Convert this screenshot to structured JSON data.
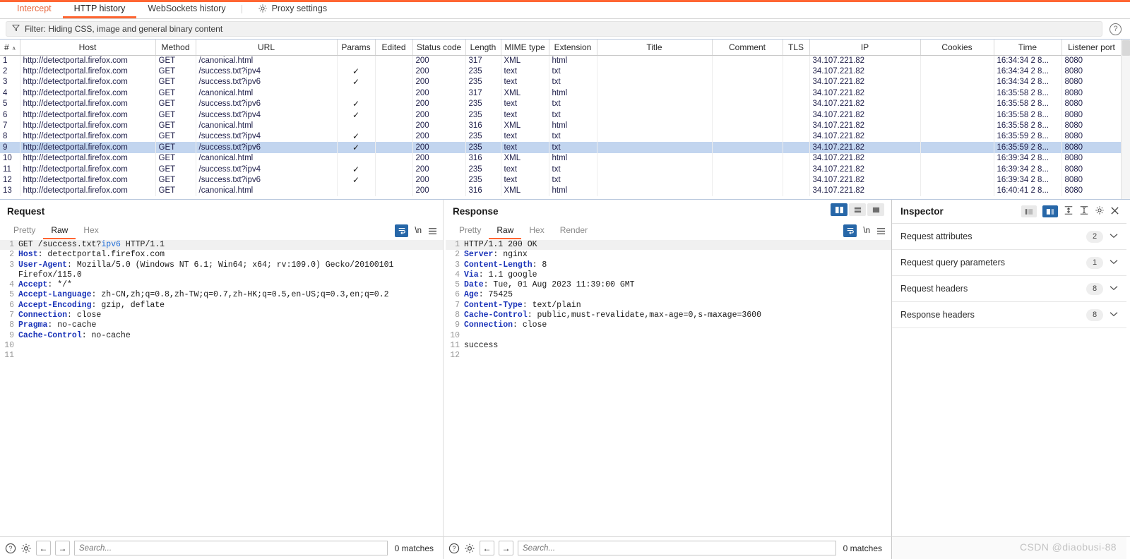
{
  "tabs": [
    {
      "label": "Intercept",
      "state": "intercept"
    },
    {
      "label": "HTTP history",
      "state": "active"
    },
    {
      "label": "WebSockets history",
      "state": "normal"
    },
    {
      "label": "Proxy settings",
      "state": "normal",
      "icon": "gear-icon"
    }
  ],
  "filter": {
    "icon": "funnel-icon",
    "text": "Filter: Hiding CSS, image and general binary content",
    "help_icon": "help-circle-icon"
  },
  "table": {
    "columns": [
      "#",
      "Host",
      "Method",
      "URL",
      "Params",
      "Edited",
      "Status code",
      "Length",
      "MIME type",
      "Extension",
      "Title",
      "Comment",
      "TLS",
      "IP",
      "Cookies",
      "Time",
      "Listener port"
    ],
    "sort_indicator": "∧",
    "check_glyph": "✓",
    "rows": [
      {
        "num": "1",
        "host": "http://detectportal.firefox.com",
        "method": "GET",
        "url": "/canonical.html",
        "params": "",
        "edited": "",
        "status": "200",
        "length": "317",
        "mime": "XML",
        "ext": "html",
        "title": "",
        "comment": "",
        "tls": "",
        "ip": "34.107.221.82",
        "cookies": "",
        "time": "16:34:34 2 8...",
        "port": "8080",
        "selected": false
      },
      {
        "num": "2",
        "host": "http://detectportal.firefox.com",
        "method": "GET",
        "url": "/success.txt?ipv4",
        "params": "✓",
        "edited": "",
        "status": "200",
        "length": "235",
        "mime": "text",
        "ext": "txt",
        "title": "",
        "comment": "",
        "tls": "",
        "ip": "34.107.221.82",
        "cookies": "",
        "time": "16:34:34 2 8...",
        "port": "8080",
        "selected": false
      },
      {
        "num": "3",
        "host": "http://detectportal.firefox.com",
        "method": "GET",
        "url": "/success.txt?ipv6",
        "params": "✓",
        "edited": "",
        "status": "200",
        "length": "235",
        "mime": "text",
        "ext": "txt",
        "title": "",
        "comment": "",
        "tls": "",
        "ip": "34.107.221.82",
        "cookies": "",
        "time": "16:34:34 2 8...",
        "port": "8080",
        "selected": false
      },
      {
        "num": "4",
        "host": "http://detectportal.firefox.com",
        "method": "GET",
        "url": "/canonical.html",
        "params": "",
        "edited": "",
        "status": "200",
        "length": "317",
        "mime": "XML",
        "ext": "html",
        "title": "",
        "comment": "",
        "tls": "",
        "ip": "34.107.221.82",
        "cookies": "",
        "time": "16:35:58 2 8...",
        "port": "8080",
        "selected": false
      },
      {
        "num": "5",
        "host": "http://detectportal.firefox.com",
        "method": "GET",
        "url": "/success.txt?ipv6",
        "params": "✓",
        "edited": "",
        "status": "200",
        "length": "235",
        "mime": "text",
        "ext": "txt",
        "title": "",
        "comment": "",
        "tls": "",
        "ip": "34.107.221.82",
        "cookies": "",
        "time": "16:35:58 2 8...",
        "port": "8080",
        "selected": false
      },
      {
        "num": "6",
        "host": "http://detectportal.firefox.com",
        "method": "GET",
        "url": "/success.txt?ipv4",
        "params": "✓",
        "edited": "",
        "status": "200",
        "length": "235",
        "mime": "text",
        "ext": "txt",
        "title": "",
        "comment": "",
        "tls": "",
        "ip": "34.107.221.82",
        "cookies": "",
        "time": "16:35:58 2 8...",
        "port": "8080",
        "selected": false
      },
      {
        "num": "7",
        "host": "http://detectportal.firefox.com",
        "method": "GET",
        "url": "/canonical.html",
        "params": "",
        "edited": "",
        "status": "200",
        "length": "316",
        "mime": "XML",
        "ext": "html",
        "title": "",
        "comment": "",
        "tls": "",
        "ip": "34.107.221.82",
        "cookies": "",
        "time": "16:35:58 2 8...",
        "port": "8080",
        "selected": false
      },
      {
        "num": "8",
        "host": "http://detectportal.firefox.com",
        "method": "GET",
        "url": "/success.txt?ipv4",
        "params": "✓",
        "edited": "",
        "status": "200",
        "length": "235",
        "mime": "text",
        "ext": "txt",
        "title": "",
        "comment": "",
        "tls": "",
        "ip": "34.107.221.82",
        "cookies": "",
        "time": "16:35:59 2 8...",
        "port": "8080",
        "selected": false
      },
      {
        "num": "9",
        "host": "http://detectportal.firefox.com",
        "method": "GET",
        "url": "/success.txt?ipv6",
        "params": "✓",
        "edited": "",
        "status": "200",
        "length": "235",
        "mime": "text",
        "ext": "txt",
        "title": "",
        "comment": "",
        "tls": "",
        "ip": "34.107.221.82",
        "cookies": "",
        "time": "16:35:59 2 8...",
        "port": "8080",
        "selected": true
      },
      {
        "num": "10",
        "host": "http://detectportal.firefox.com",
        "method": "GET",
        "url": "/canonical.html",
        "params": "",
        "edited": "",
        "status": "200",
        "length": "316",
        "mime": "XML",
        "ext": "html",
        "title": "",
        "comment": "",
        "tls": "",
        "ip": "34.107.221.82",
        "cookies": "",
        "time": "16:39:34 2 8...",
        "port": "8080",
        "selected": false
      },
      {
        "num": "11",
        "host": "http://detectportal.firefox.com",
        "method": "GET",
        "url": "/success.txt?ipv4",
        "params": "✓",
        "edited": "",
        "status": "200",
        "length": "235",
        "mime": "text",
        "ext": "txt",
        "title": "",
        "comment": "",
        "tls": "",
        "ip": "34.107.221.82",
        "cookies": "",
        "time": "16:39:34 2 8...",
        "port": "8080",
        "selected": false
      },
      {
        "num": "12",
        "host": "http://detectportal.firefox.com",
        "method": "GET",
        "url": "/success.txt?ipv6",
        "params": "✓",
        "edited": "",
        "status": "200",
        "length": "235",
        "mime": "text",
        "ext": "txt",
        "title": "",
        "comment": "",
        "tls": "",
        "ip": "34.107.221.82",
        "cookies": "",
        "time": "16:39:34 2 8...",
        "port": "8080",
        "selected": false
      },
      {
        "num": "13",
        "host": "http://detectportal.firefox.com",
        "method": "GET",
        "url": "/canonical.html",
        "params": "",
        "edited": "",
        "status": "200",
        "length": "316",
        "mime": "XML",
        "ext": "html",
        "title": "",
        "comment": "",
        "tls": "",
        "ip": "34.107.221.82",
        "cookies": "",
        "time": "16:40:41 2 8...",
        "port": "8080",
        "selected": false
      }
    ]
  },
  "request": {
    "title": "Request",
    "tabs": [
      {
        "label": "Pretty",
        "active": false
      },
      {
        "label": "Raw",
        "active": true
      },
      {
        "label": "Hex",
        "active": false
      }
    ],
    "newline_label": "\\n",
    "lines": [
      {
        "n": "1",
        "plain_before": "GET /success.txt?",
        "query": "ipv6",
        "plain_after": " HTTP/1.1"
      },
      {
        "n": "2",
        "key": "Host",
        "value": ": detectportal.firefox.com"
      },
      {
        "n": "3",
        "key": "User-Agent",
        "value": ": Mozilla/5.0 (Windows NT 6.1; Win64; x64; rv:109.0) Gecko/20100101"
      },
      {
        "n": "",
        "value": "Firefox/115.0"
      },
      {
        "n": "4",
        "key": "Accept",
        "value": ": */*"
      },
      {
        "n": "5",
        "key": "Accept-Language",
        "value": ": zh-CN,zh;q=0.8,zh-TW;q=0.7,zh-HK;q=0.5,en-US;q=0.3,en;q=0.2"
      },
      {
        "n": "6",
        "key": "Accept-Encoding",
        "value": ": gzip, deflate"
      },
      {
        "n": "7",
        "key": "Connection",
        "value": ": close"
      },
      {
        "n": "8",
        "key": "Pragma",
        "value": ": no-cache"
      },
      {
        "n": "9",
        "key": "Cache-Control",
        "value": ": no-cache"
      },
      {
        "n": "10",
        "value": ""
      },
      {
        "n": "11",
        "value": ""
      }
    ],
    "search_placeholder": "Search...",
    "matches": "0 matches"
  },
  "response": {
    "title": "Response",
    "tabs": [
      {
        "label": "Pretty",
        "active": false
      },
      {
        "label": "Raw",
        "active": true
      },
      {
        "label": "Hex",
        "active": false
      },
      {
        "label": "Render",
        "active": false
      }
    ],
    "newline_label": "\\n",
    "layout_buttons": [
      {
        "name": "side-by-side",
        "active": true
      },
      {
        "name": "stacked",
        "active": false
      },
      {
        "name": "single",
        "active": false
      }
    ],
    "lines": [
      {
        "n": "1",
        "value": "HTTP/1.1 200 OK"
      },
      {
        "n": "2",
        "key": "Server",
        "value": ": nginx"
      },
      {
        "n": "3",
        "key": "Content-Length",
        "value": ": 8"
      },
      {
        "n": "4",
        "key": "Via",
        "value": ": 1.1 google"
      },
      {
        "n": "5",
        "key": "Date",
        "value": ": Tue, 01 Aug 2023 11:39:00 GMT"
      },
      {
        "n": "6",
        "key": "Age",
        "value": ": 75425"
      },
      {
        "n": "7",
        "key": "Content-Type",
        "value": ": text/plain"
      },
      {
        "n": "8",
        "key": "Cache-Control",
        "value": ": public,must-revalidate,max-age=0,s-maxage=3600"
      },
      {
        "n": "9",
        "key": "Connection",
        "value": ": close"
      },
      {
        "n": "10",
        "value": ""
      },
      {
        "n": "11",
        "value": "success"
      },
      {
        "n": "12",
        "value": ""
      }
    ],
    "search_placeholder": "Search...",
    "matches": "0 matches"
  },
  "inspector": {
    "title": "Inspector",
    "sections": [
      {
        "label": "Request attributes",
        "count": "2"
      },
      {
        "label": "Request query parameters",
        "count": "1"
      },
      {
        "label": "Request headers",
        "count": "8"
      },
      {
        "label": "Response headers",
        "count": "8"
      }
    ],
    "chevron": "⌄",
    "watermark": "CSDN @diaobusi-88"
  },
  "colors": {
    "accent": "#ff6633",
    "intercept": "#e8663c",
    "selection": "#c2d5ef",
    "blue_button": "#2767a8",
    "header_key": "#1a33b8"
  }
}
